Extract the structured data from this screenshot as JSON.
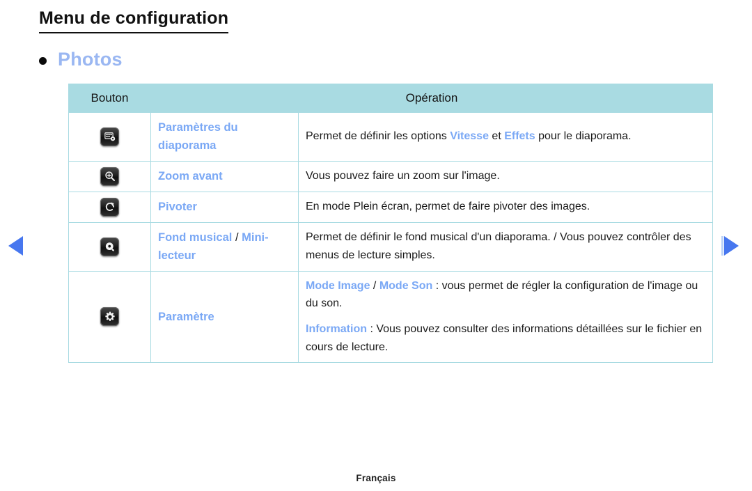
{
  "page": {
    "title": "Menu de configuration",
    "section_bullet_label": "Photos",
    "footer_language": "Français"
  },
  "colors": {
    "accent_blue": "#9ab7f2",
    "inline_accent_blue": "#7aa8f5",
    "table_header_bg": "#a9dbe2",
    "table_border": "#a9dbe2",
    "arrow_blue": "#4777ef",
    "text_black": "#1a1a1a"
  },
  "table": {
    "headers": {
      "button": "Bouton",
      "operation": "Opération"
    },
    "rows": [
      {
        "icon": "slideshow-settings-icon",
        "name": "Paramètres du diaporama",
        "name_parts": [
          {
            "text": "Paramètres du diaporama",
            "style": "accent"
          }
        ],
        "operation_paragraphs": [
          [
            {
              "text": "Permet de définir les options ",
              "style": "plain"
            },
            {
              "text": "Vitesse",
              "style": "accent"
            },
            {
              "text": " et ",
              "style": "plain"
            },
            {
              "text": "Effets",
              "style": "accent"
            },
            {
              "text": " pour le diaporama.",
              "style": "plain"
            }
          ]
        ]
      },
      {
        "icon": "zoom-in-icon",
        "name": "Zoom avant",
        "name_parts": [
          {
            "text": "Zoom avant",
            "style": "accent"
          }
        ],
        "operation_paragraphs": [
          [
            {
              "text": "Vous pouvez faire un zoom sur l'image.",
              "style": "plain"
            }
          ]
        ]
      },
      {
        "icon": "rotate-icon",
        "name": "Pivoter",
        "name_parts": [
          {
            "text": "Pivoter",
            "style": "accent"
          }
        ],
        "operation_paragraphs": [
          [
            {
              "text": "En mode Plein écran, permet de faire pivoter des images.",
              "style": "plain"
            }
          ]
        ]
      },
      {
        "icon": "music-disc-icon",
        "name": "Fond musical / Mini-lecteur",
        "name_parts": [
          {
            "text": "Fond musical",
            "style": "accent"
          },
          {
            "text": " / ",
            "style": "separator"
          },
          {
            "text": "Mini-lecteur",
            "style": "accent"
          }
        ],
        "operation_paragraphs": [
          [
            {
              "text": "Permet de définir le fond musical d'un diaporama. / Vous pouvez contrôler des menus de lecture simples.",
              "style": "plain"
            }
          ]
        ]
      },
      {
        "icon": "gear-icon",
        "name": "Paramètre",
        "name_parts": [
          {
            "text": "Paramètre",
            "style": "accent"
          }
        ],
        "operation_paragraphs": [
          [
            {
              "text": "Mode Image",
              "style": "accent"
            },
            {
              "text": " / ",
              "style": "separator"
            },
            {
              "text": "Mode Son",
              "style": "accent"
            },
            {
              "text": " : vous permet de régler la configuration de l'image ou du son.",
              "style": "plain"
            }
          ],
          [
            {
              "text": "Information",
              "style": "accent"
            },
            {
              "text": " : Vous pouvez consulter des informations détaillées sur le fichier en cours de lecture.",
              "style": "plain"
            }
          ]
        ]
      }
    ]
  },
  "navigation": {
    "prev_label": "previous-page-arrow",
    "next_label": "next-page-arrow"
  }
}
